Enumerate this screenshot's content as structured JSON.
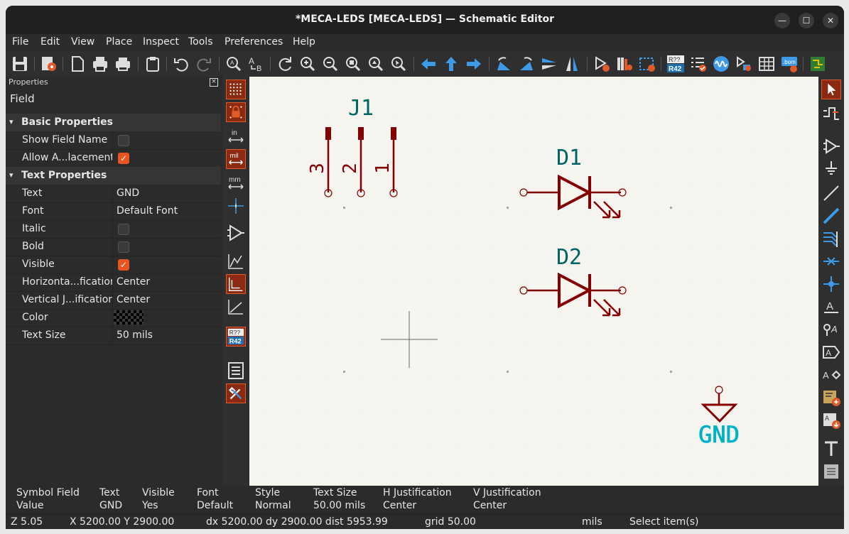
{
  "window": {
    "title": "*MECA-LEDS [MECA-LEDS] — Schematic Editor",
    "controls": {
      "minimize": "—",
      "maximize": "☐",
      "close": "✕"
    }
  },
  "menu": [
    "File",
    "Edit",
    "View",
    "Place",
    "Inspect",
    "Tools",
    "Preferences",
    "Help"
  ],
  "properties": {
    "panel_title": "Properties",
    "field_label": "Field",
    "basic": {
      "label": "Basic Properties",
      "show_field_name": "Show Field Name",
      "allow_autoplacement": "Allow A...lacement"
    },
    "text": {
      "label": "Text Properties",
      "text_key": "Text",
      "text_value": "GND",
      "font_key": "Font",
      "font_value": "Default Font",
      "italic_key": "Italic",
      "bold_key": "Bold",
      "visible_key": "Visible",
      "hjust_key": "Horizonta...fication",
      "hjust_value": "Center",
      "vjust_key": "Vertical J...ification",
      "vjust_value": "Center",
      "color_key": "Color",
      "size_key": "Text Size",
      "size_value": "50 mils"
    },
    "checked": {
      "show_field_name": false,
      "allow_autoplacement": true,
      "italic": false,
      "bold": false,
      "visible": true
    }
  },
  "left_toolbar": {
    "units": {
      "in": "in",
      "mil": "mil",
      "mm": "mm"
    },
    "annotate": {
      "top": "R??",
      "bottom": "R42"
    }
  },
  "toolbar": {
    "annotate": {
      "top": "R??",
      "bottom": "R42"
    },
    "bom_label": ".bom"
  },
  "schematic": {
    "connector_ref": "J1",
    "pins": [
      "3",
      "2",
      "1"
    ],
    "diode1": "D1",
    "diode2": "D2",
    "power": "GND",
    "colors": {
      "symbol": "#840000",
      "reference": "#006464",
      "power_text": "#00b2c8",
      "background": "#f5f4ef"
    }
  },
  "message_panel": {
    "symbol_field": {
      "label": "Symbol Field",
      "value": "Value"
    },
    "text": {
      "label": "Text",
      "value": "GND"
    },
    "visible": {
      "label": "Visible",
      "value": "Yes"
    },
    "font": {
      "label": "Font",
      "value": "Default"
    },
    "style": {
      "label": "Style",
      "value": "Normal"
    },
    "text_size": {
      "label": "Text Size",
      "value": "50.00 mils"
    },
    "hjust": {
      "label": "H Justification",
      "value": "Center"
    },
    "vjust": {
      "label": "V Justification",
      "value": "Center"
    }
  },
  "status": {
    "zoom": "Z 5.05",
    "xy": "X 5200.00  Y 2900.00",
    "delta": "dx 5200.00  dy 2900.00  dist 5953.99",
    "grid": "grid 50.00",
    "units": "mils",
    "mode": "Select item(s)"
  }
}
